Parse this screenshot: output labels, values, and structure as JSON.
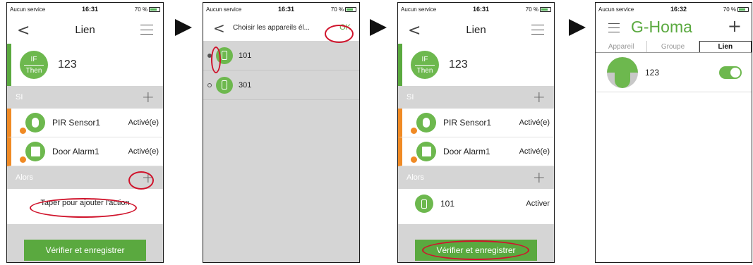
{
  "status": {
    "carrier": "Aucun service",
    "battery": "70 %"
  },
  "screen1": {
    "time": "16:31",
    "title": "Lien",
    "rule_icon_top": "IF",
    "rule_icon_bottom": "Then",
    "rule_name": "123",
    "si_label": "SI",
    "devices": [
      {
        "name": "PIR Sensor1",
        "state": "Activé(e)"
      },
      {
        "name": "Door Alarm1",
        "state": "Activé(e)"
      }
    ],
    "alors_label": "Alors",
    "tap_text": "Taper pour ajouter l'action",
    "verify_label": "Vérifier et enregistrer"
  },
  "screen2": {
    "time": "16:31",
    "title": "Choisir les appareils él...",
    "ok_label": "OK",
    "devices": [
      {
        "name": "101"
      },
      {
        "name": "301"
      }
    ]
  },
  "screen3": {
    "time": "16:31",
    "title": "Lien",
    "rule_icon_top": "IF",
    "rule_icon_bottom": "Then",
    "rule_name": "123",
    "si_label": "SI",
    "devices": [
      {
        "name": "PIR Sensor1",
        "state": "Activé(e)"
      },
      {
        "name": "Door Alarm1",
        "state": "Activé(e)"
      }
    ],
    "alors_label": "Alors",
    "action": {
      "name": "101",
      "state": "Activer"
    },
    "verify_label": "Vérifier et enregistrer"
  },
  "screen4": {
    "time": "16:32",
    "brand": "G-Homa",
    "tabs": [
      "Appareil",
      "Groupe",
      "Lien"
    ],
    "link_name": "123"
  },
  "colors": {
    "accent": "#5aa93f",
    "warning": "#f08a24",
    "highlight": "#d0142c"
  }
}
